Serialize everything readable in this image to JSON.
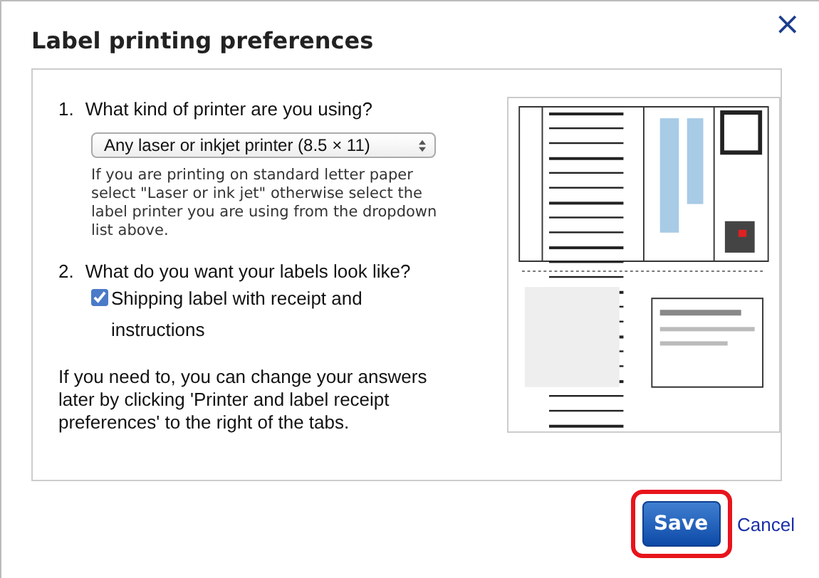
{
  "dialog": {
    "title": "Label printing preferences",
    "close": "×"
  },
  "questions": [
    {
      "number": "1.",
      "kind": "select",
      "question": "What kind of printer are you using?",
      "value": "Any laser or inkjet printer (8.5 × 11)",
      "help": "If you are printing on standard letter paper select \"Laser or ink jet\" otherwise select the label printer you are using from the dropdown list above."
    },
    {
      "number": "2.",
      "kind": "checkbox",
      "question": "What do you want your labels look like?",
      "option": "Shipping label with receipt and instructions",
      "checked": true
    }
  ],
  "note": "If you need to, you can change your answers later by clicking 'Printer and label receipt preferences' to the right of the tabs.",
  "buttons": {
    "save": {
      "label": "Save",
      "highlighted": true
    },
    "cancel": "Cancel"
  }
}
